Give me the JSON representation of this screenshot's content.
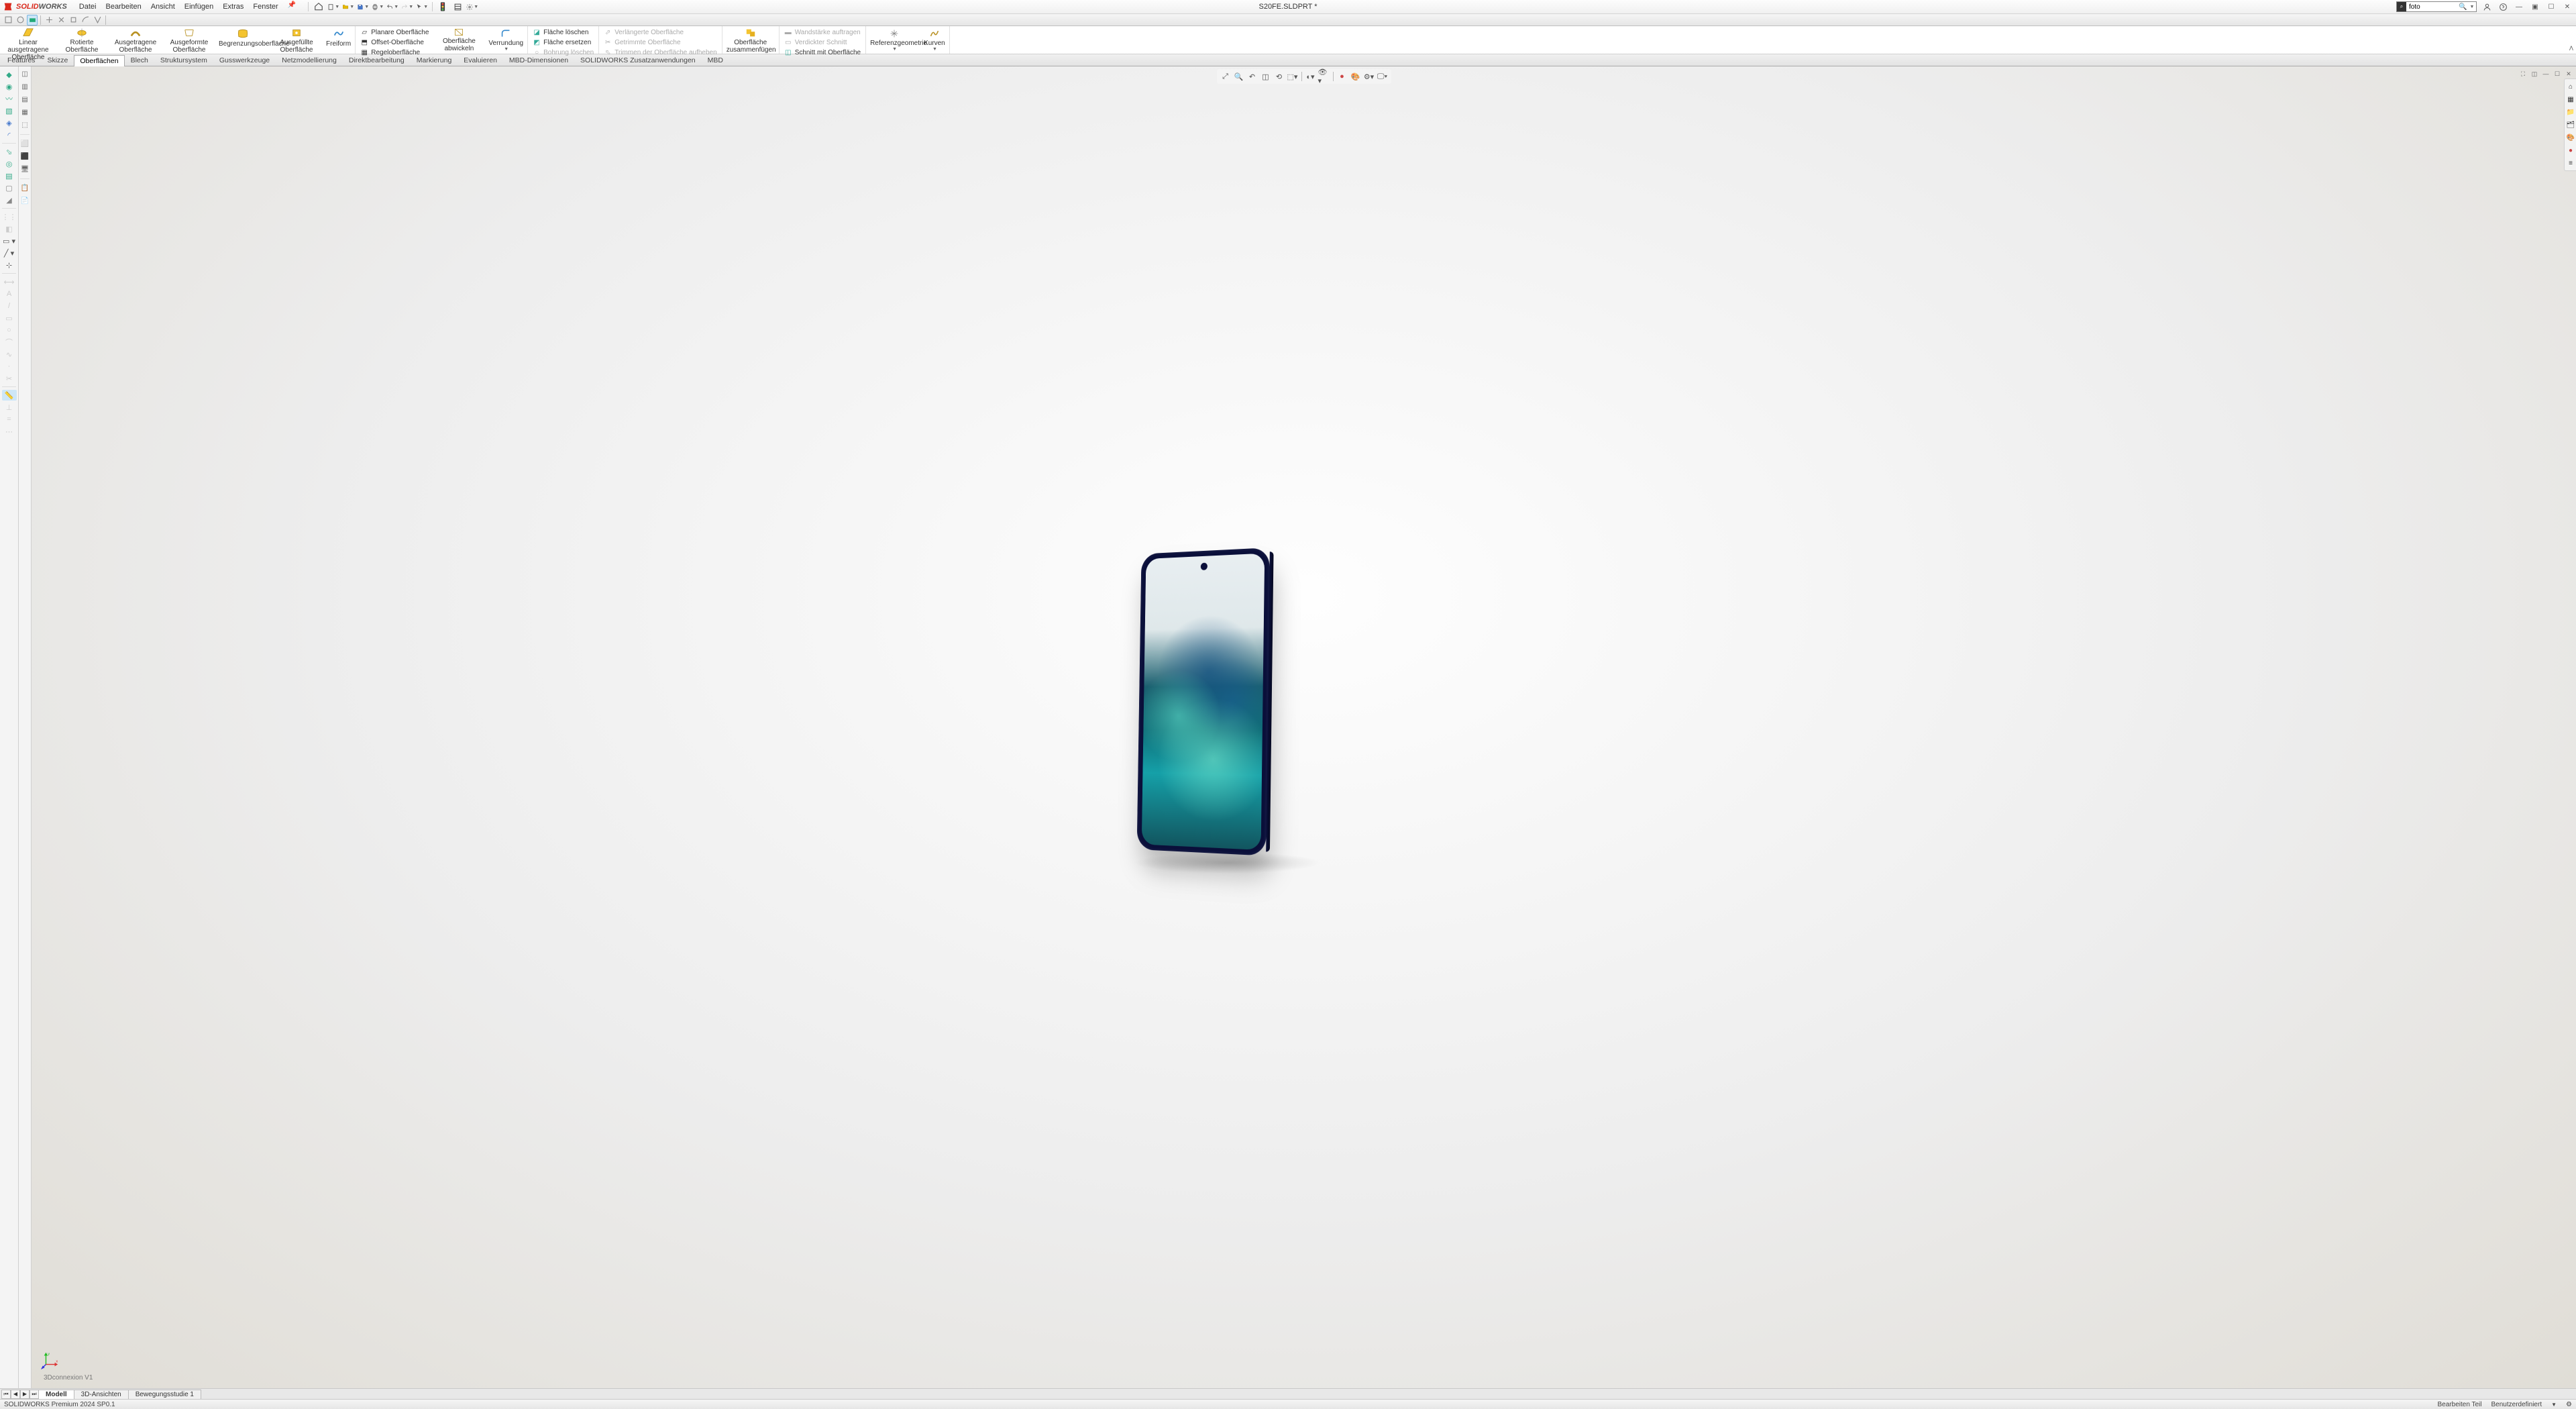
{
  "app": {
    "logo1": "SOLID",
    "logo2": "WORKS"
  },
  "menu": [
    "Datei",
    "Bearbeiten",
    "Ansicht",
    "Einfügen",
    "Extras",
    "Fenster"
  ],
  "doc_title": "S20FE.SLDPRT *",
  "search_placeholder": "foto",
  "ribbon": {
    "big": [
      {
        "label": "Linear ausgetragene Oberfläche"
      },
      {
        "label": "Rotierte Oberfläche"
      },
      {
        "label": "Ausgetragene Oberfläche"
      },
      {
        "label": "Ausgeformte Oberfläche"
      },
      {
        "label": "Begrenzungsoberfläche"
      },
      {
        "label": "Ausgefüllte Oberfläche"
      },
      {
        "label": "Freiform"
      }
    ],
    "col1": [
      "Planare Oberfläche",
      "Offset-Oberfläche",
      "Regeloberfläche"
    ],
    "col1b": [
      {
        "l": "Oberfläche abwickeln"
      },
      {
        "l": "Verrundung"
      }
    ],
    "col2": [
      "Fläche löschen",
      "Fläche ersetzen",
      "Bohrung löschen"
    ],
    "col2d": [
      "Verlängerte Oberfläche",
      "Getrimmte Oberfläche",
      "Trimmen der Oberfläche aufheben"
    ],
    "mid": {
      "label": "Oberfläche zusammenfügen"
    },
    "col3": [
      "Wandstärke auftragen",
      "Verdickter Schnitt",
      "Schnitt mit Oberfläche"
    ],
    "right": [
      {
        "l": "Referenzgeometrie"
      },
      {
        "l": "Kurven"
      }
    ]
  },
  "tabs": [
    "Features",
    "Skizze",
    "Oberflächen",
    "Blech",
    "Struktursystem",
    "Gusswerkzeuge",
    "Netzmodellierung",
    "Direktbearbeitung",
    "Markierung",
    "Evaluieren",
    "MBD-Dimensionen",
    "SOLIDWORKS Zusatzanwendungen",
    "MBD"
  ],
  "active_tab": "Oberflächen",
  "bottom_tabs": [
    "Modell",
    "3D-Ansichten",
    "Bewegungsstudie 1"
  ],
  "active_bottom": "Modell",
  "conn_label": "3Dconnexion V1",
  "status": {
    "left": "SOLIDWORKS Premium 2024 SP0.1",
    "right1": "Bearbeiten Teil",
    "right2": "Benutzerdefiniert"
  }
}
